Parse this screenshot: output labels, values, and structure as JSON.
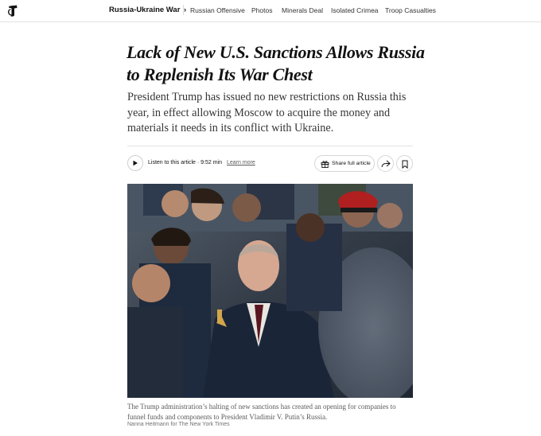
{
  "nav": {
    "logo_icon": "nyt-t-logo-icon",
    "primary": "Russia-Ukraine War",
    "primary_chevron": "›",
    "links": [
      "Russian Offensive",
      "Photos",
      "Minerals Deal",
      "Isolated Crimea",
      "Troop Casualties"
    ]
  },
  "article": {
    "headline": "Lack of New U.S. Sanctions Allows Russia to Replenish Its War Chest",
    "summary": "President Trump has issued no new restrictions on Russia this year, in effect allowing Moscow to acquire the money and materials it needs in its conflict with Ukraine."
  },
  "toolbar": {
    "play_icon": "play-icon",
    "listen_label": "Listen to this article · 9:52 min",
    "learn_more": "Learn more",
    "share_full_label": "Share full article",
    "gift_icon": "gift-icon",
    "share_icon": "share-arrow-icon",
    "bookmark_icon": "bookmark-icon"
  },
  "image": {
    "caption": "The Trump administration’s halting of new sanctions has created an opening for companies to funnel funds and components to President Vladimir V. Putin’s Russia.",
    "credit": "Nanna Heitmann for The New York Times"
  },
  "colors": {
    "text": "#121212",
    "muted": "#5a5a5a",
    "border": "#e2e2e2"
  }
}
